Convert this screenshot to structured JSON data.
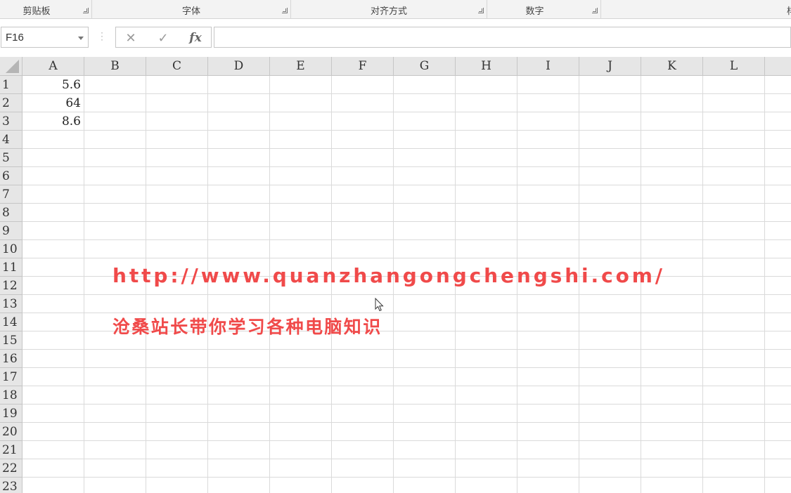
{
  "ribbon": {
    "groups": [
      {
        "label": "剪贴板"
      },
      {
        "label": "字体"
      },
      {
        "label": "对齐方式"
      },
      {
        "label": "数字"
      }
    ],
    "cut_label": "样"
  },
  "formula_bar": {
    "name_box": "F16",
    "cancel_icon": "✕",
    "enter_icon": "✓",
    "fx_label": "fx",
    "formula": ""
  },
  "sheet": {
    "columns": [
      "A",
      "B",
      "C",
      "D",
      "E",
      "F",
      "G",
      "H",
      "I",
      "J",
      "K",
      "L"
    ],
    "rows": [
      "1",
      "2",
      "3",
      "4",
      "5",
      "6",
      "7",
      "8",
      "9",
      "10",
      "11",
      "12",
      "13",
      "14",
      "15",
      "16",
      "17",
      "18",
      "19",
      "20",
      "21",
      "22",
      "23"
    ],
    "cells": {
      "A1": "5.6",
      "A2": "64",
      "A3": "8.6"
    },
    "active_cell": "F16"
  },
  "watermark": {
    "url": "http://www.quanzhangongchengshi.com/",
    "slogan": "沧桑站长带你学习各种电脑知识",
    "color": "#f04a4a"
  }
}
